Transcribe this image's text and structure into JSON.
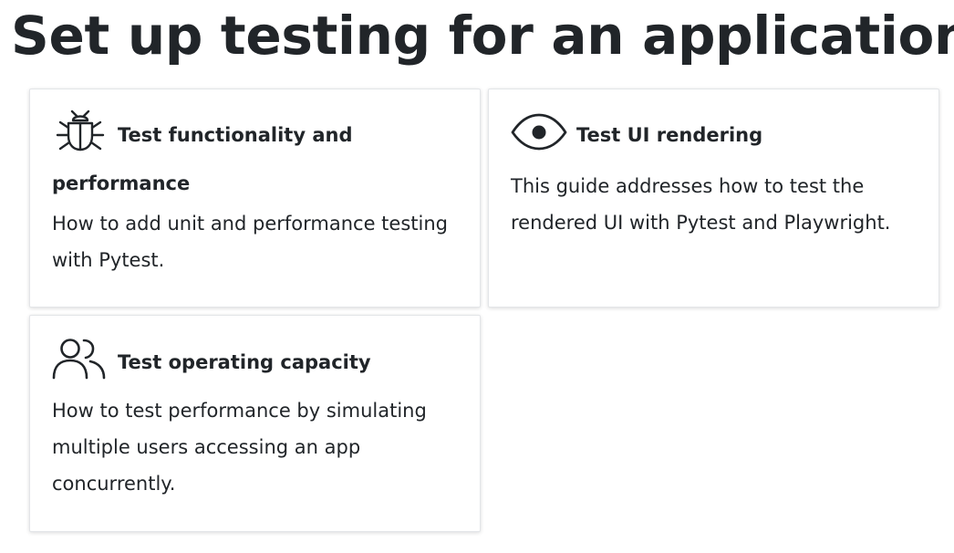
{
  "page": {
    "title": "Set up testing for an application"
  },
  "cards": [
    {
      "icon": "bug-icon",
      "title": "Test functionality and performance",
      "description": "How to add unit and performance testing with Pytest."
    },
    {
      "icon": "eye-icon",
      "title": "Test UI rendering",
      "description": "This guide addresses how to test the rendered UI with Pytest and Playwright."
    },
    {
      "icon": "users-icon",
      "title": "Test operating capacity",
      "description": "How to test performance by simulating multiple users accessing an app concurrently."
    }
  ],
  "colors": {
    "text": "#212529",
    "card_border": "#e3e5e8",
    "background": "#ffffff"
  }
}
